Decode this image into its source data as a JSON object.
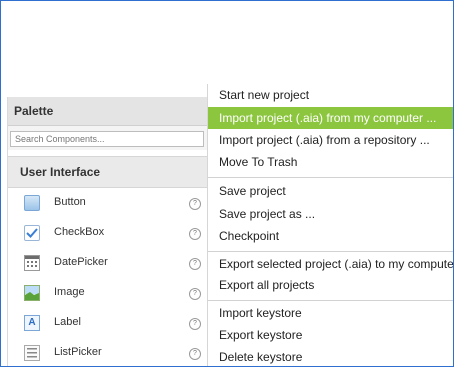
{
  "palette": {
    "title": "Palette",
    "search_placeholder": "Search Components...",
    "section": "User Interface",
    "help_glyph": "?",
    "label_icon_glyph": "A",
    "components": [
      {
        "label": "Button",
        "icon": "button-icon"
      },
      {
        "label": "CheckBox",
        "icon": "checkbox-icon"
      },
      {
        "label": "DatePicker",
        "icon": "datepicker-icon"
      },
      {
        "label": "Image",
        "icon": "image-icon"
      },
      {
        "label": "Label",
        "icon": "label-icon"
      },
      {
        "label": "ListPicker",
        "icon": "listpicker-icon"
      }
    ]
  },
  "menu": {
    "items": [
      {
        "label": "Start new project"
      },
      {
        "label": "Import project (.aia) from my computer ...",
        "highlighted": true
      },
      {
        "label": "Import project (.aia) from a repository ..."
      },
      {
        "label": "Move To Trash"
      },
      {
        "label": "Save project"
      },
      {
        "label": "Save project as ..."
      },
      {
        "label": "Checkpoint"
      },
      {
        "label": "Export selected project (.aia) to my computer"
      },
      {
        "label": "Export all projects"
      },
      {
        "label": "Import keystore"
      },
      {
        "label": "Export keystore"
      },
      {
        "label": "Delete keystore"
      }
    ]
  },
  "colors": {
    "highlight": "#8cc63f",
    "frame_border": "#2f6fd0"
  }
}
